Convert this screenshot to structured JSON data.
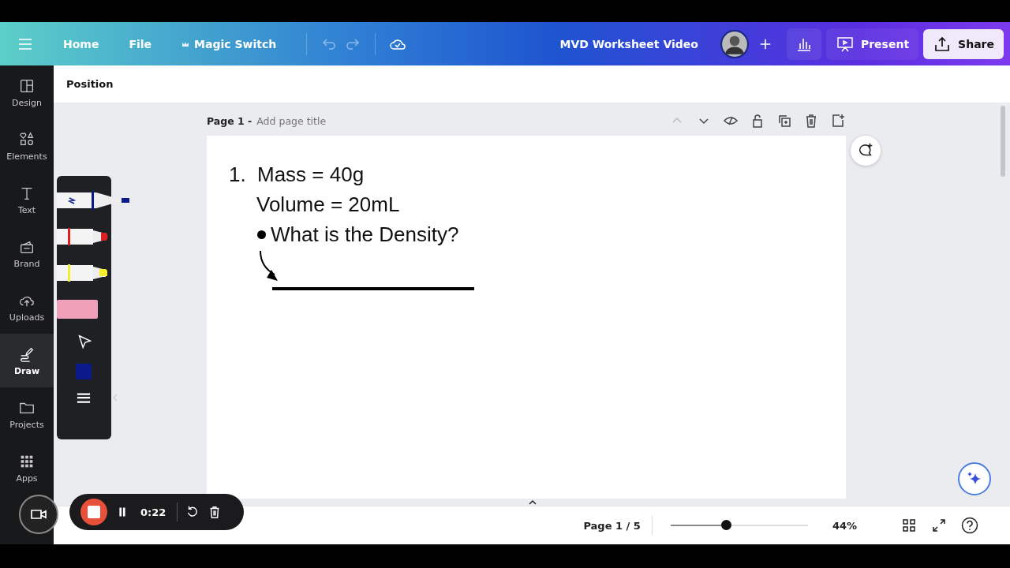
{
  "header": {
    "menu": [
      "Home",
      "File",
      "Magic Switch"
    ],
    "title": "MVD Worksheet Video",
    "present": "Present",
    "share": "Share"
  },
  "sidebar": {
    "items": [
      {
        "label": "Design",
        "selected": false
      },
      {
        "label": "Elements",
        "selected": false
      },
      {
        "label": "Text",
        "selected": false
      },
      {
        "label": "Brand",
        "selected": false
      },
      {
        "label": "Uploads",
        "selected": false
      },
      {
        "label": "Draw",
        "selected": true
      },
      {
        "label": "Projects",
        "selected": false
      },
      {
        "label": "Apps",
        "selected": false
      }
    ]
  },
  "context_bar": {
    "label": "Position"
  },
  "page": {
    "label": "Page 1 -",
    "title_placeholder": "Add page title",
    "lines": [
      {
        "kind": "numbered",
        "marker": "1.",
        "text": "Mass = 40g"
      },
      {
        "kind": "plain",
        "text": "Volume = 20mL"
      },
      {
        "kind": "bullet",
        "text": "What is the Density?"
      }
    ]
  },
  "draw_panel": {
    "tools": [
      {
        "kind": "pen"
      },
      {
        "kind": "marker"
      },
      {
        "kind": "highlighter"
      },
      {
        "kind": "eraser"
      }
    ]
  },
  "recording": {
    "time": "0:22"
  },
  "footer": {
    "page_indicator": "Page 1 / 5",
    "zoom": {
      "level": 0.38
    },
    "zoom_reading": "44%"
  }
}
